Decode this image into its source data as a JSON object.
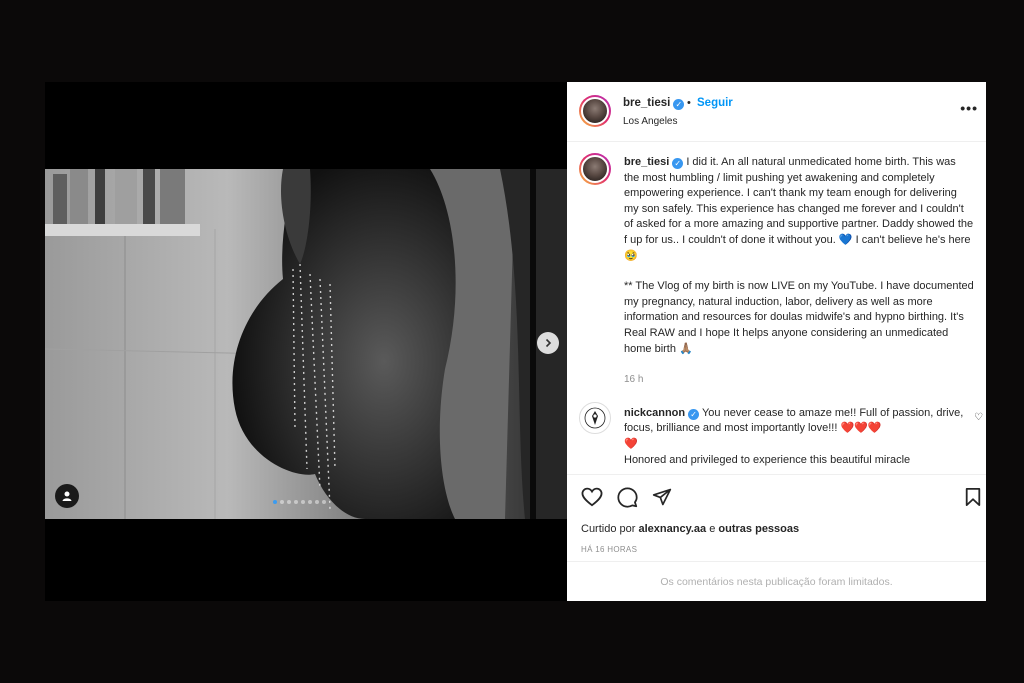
{
  "post": {
    "username": "bre_tiesi",
    "separator": "•",
    "follow_label": "Seguir",
    "location": "Los Angeles",
    "more_label": "•••"
  },
  "media": {
    "slide_count": 8,
    "active_slide": 1
  },
  "caption": {
    "username": "bre_tiesi",
    "paragraph1": "I did it. An all natural unmedicated home birth. This was the most humbling / limit pushing yet awakening and completely empowering experience. I can't thank my team enough for delivering my son safely. This experience has changed me forever and I couldn't of asked for a more amazing and supportive partner. Daddy showed the f up for us.. I couldn't of done it without you. 💙 I can't believe he's here 🥹",
    "paragraph2": "** The Vlog of my birth is now LIVE on my YouTube. I have documented my pregnancy, natural induction, labor, delivery as well as more information and resources for doulas midwife's and hypno birthing. It's Real RAW and I hope It helps anyone considering an unmedicated home birth 🙏🏽",
    "time": "16 h"
  },
  "comment": {
    "username": "nickcannon",
    "text": "You never cease to amaze me!! Full of passion, drive, focus, brilliance and most importantly love!!!",
    "hearts": "❤️❤️❤️",
    "heart_last": "❤️",
    "text2": "Honored and privileged to experience this beautiful miracle"
  },
  "footer": {
    "liked_prefix": "Curtido por",
    "liked_user": "alexnancy.aa",
    "liked_mid": "e",
    "liked_others": "outras pessoas",
    "time_ago": "HÁ 16 HORAS",
    "limited_notice": "Os comentários nesta publicação foram limitados."
  },
  "colors": {
    "follow": "#0095f6",
    "verified": "#3897f0",
    "active_dot": "#3b9bf0",
    "page_bg": "#0b0909"
  }
}
